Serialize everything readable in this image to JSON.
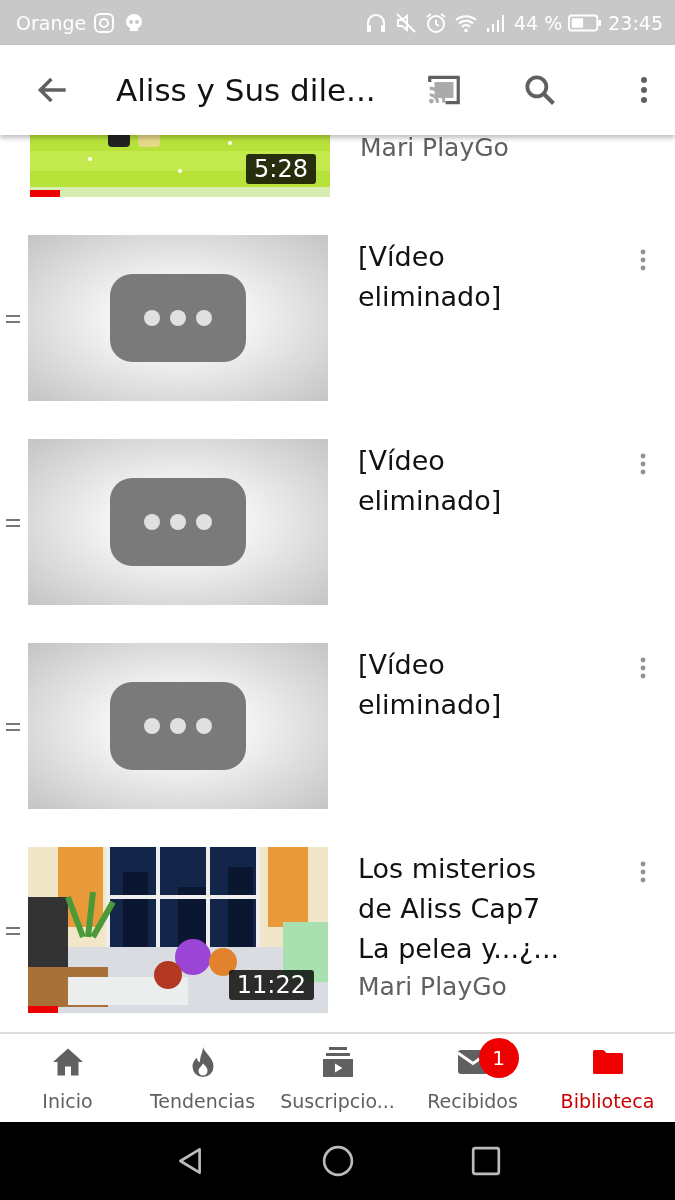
{
  "status_bar": {
    "carrier": "Orange",
    "battery": "44 %",
    "time": "23:45"
  },
  "app_bar": {
    "title": "Aliss y Sus dile..."
  },
  "videos": [
    {
      "kind": "video",
      "channel": "Mari PlayGo",
      "duration": "5:28",
      "level": 0.1,
      "partial": true
    },
    {
      "kind": "deleted",
      "title": "[Vídeo eliminado]"
    },
    {
      "kind": "deleted",
      "title": "[Vídeo eliminado]"
    },
    {
      "kind": "deleted",
      "title": "[Vídeo eliminado]"
    },
    {
      "kind": "video",
      "title": "Los misterios de Aliss Cap7 La pelea y...¿...",
      "channel": "Mari PlayGo",
      "duration": "11:22",
      "level": 0.1,
      "partial": false
    }
  ],
  "bottom_nav": [
    {
      "label": "Inicio",
      "selected": false
    },
    {
      "label": "Tendencias",
      "selected": false
    },
    {
      "label": "Suscripcio...",
      "selected": false
    },
    {
      "label": "Recibidos",
      "selected": false,
      "badge": "1"
    },
    {
      "label": "Biblioteca",
      "selected": true
    }
  ]
}
